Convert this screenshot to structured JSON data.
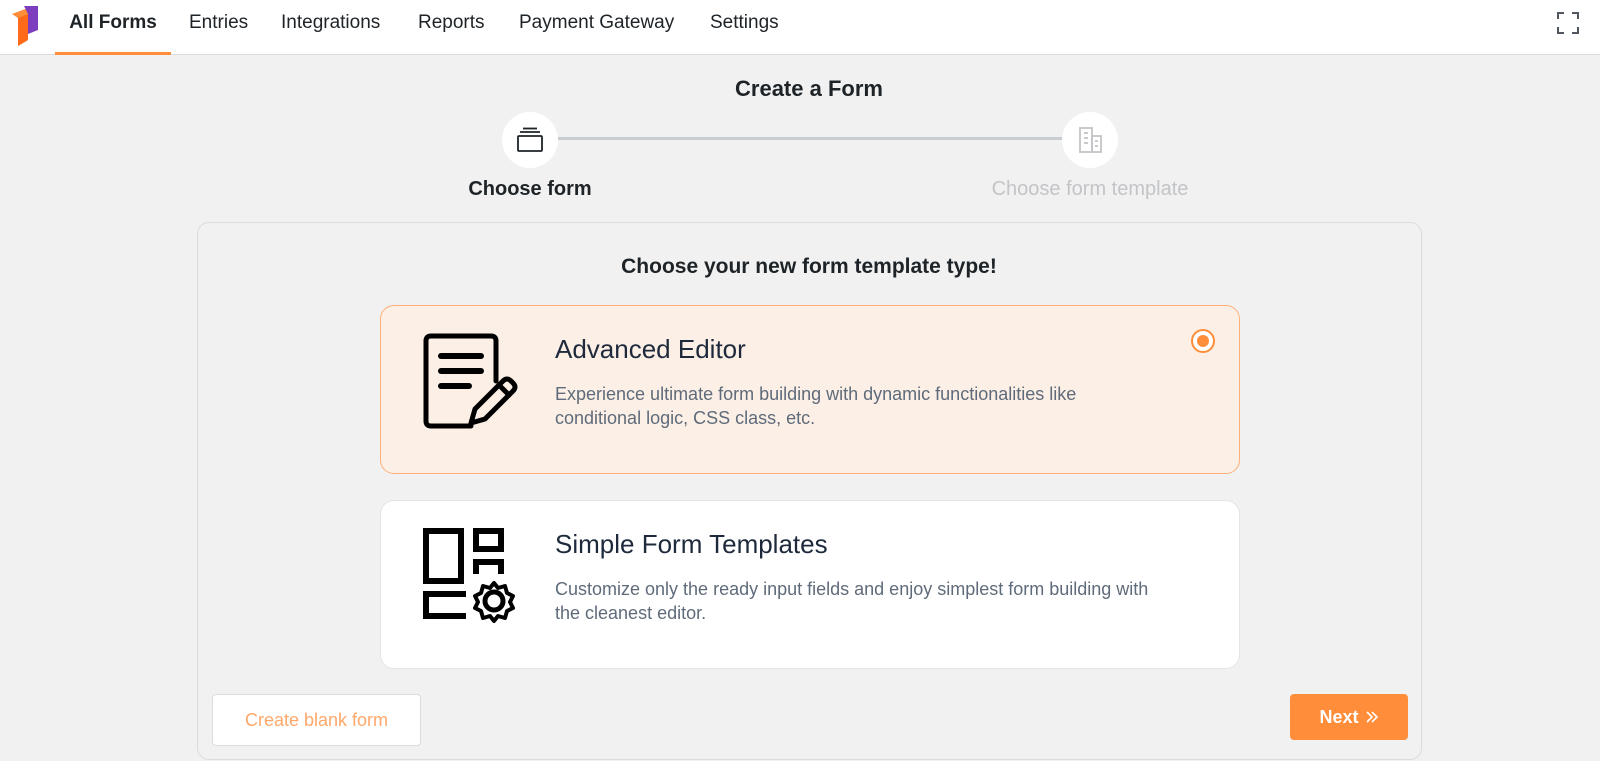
{
  "nav": {
    "items": [
      {
        "label": "All Forms",
        "active": true
      },
      {
        "label": "Entries",
        "active": false
      },
      {
        "label": "Integrations",
        "active": false
      },
      {
        "label": "Reports",
        "active": false
      },
      {
        "label": "Payment Gateway",
        "active": false
      },
      {
        "label": "Settings",
        "active": false
      }
    ],
    "fullscreen_icon": "fullscreen-icon",
    "logo_icon": "app-logo"
  },
  "stepper": {
    "title": "Create a Form",
    "steps": [
      {
        "label": "Choose form",
        "icon": "layers-icon",
        "active": true
      },
      {
        "label": "Choose form template",
        "icon": "building-icon",
        "active": false
      }
    ]
  },
  "card": {
    "title": "Choose your new form template type!",
    "options": [
      {
        "title": "Advanced Editor",
        "description": "Experience ultimate form building with dynamic functionalities like conditional logic, CSS class, etc.",
        "icon": "document-edit-icon",
        "selected": true
      },
      {
        "title": "Simple Form Templates",
        "description": "Customize only the ready input fields and enjoy simplest form building with the cleanest editor.",
        "icon": "layout-settings-icon",
        "selected": false
      }
    ],
    "blank_button": "Create blank form",
    "next_button": "Next"
  },
  "colors": {
    "accent": "#ff8d3a",
    "selected_bg": "#fbefe6",
    "page_bg": "#f1f1f1"
  }
}
